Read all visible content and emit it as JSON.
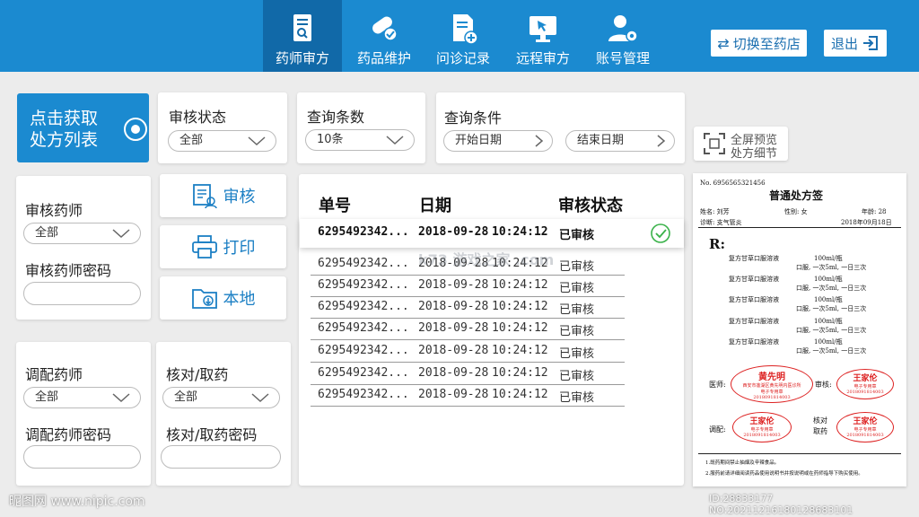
{
  "nav": {
    "items": [
      {
        "label": "药师审方",
        "icon": "clipboard-search-icon",
        "active": true
      },
      {
        "label": "药品维护",
        "icon": "pills-icon"
      },
      {
        "label": "问诊记录",
        "icon": "document-add-icon"
      },
      {
        "label": "远程审方",
        "icon": "monitor-cursor-icon"
      },
      {
        "label": "账号管理",
        "icon": "user-gear-icon"
      }
    ],
    "switch_store": "切换至药店",
    "logout": "退出"
  },
  "fetch_button": "点击获取处方列表",
  "filters": {
    "review_status": {
      "title": "审核状态",
      "value": "全部"
    },
    "query_count": {
      "title": "查询条数",
      "value": "10条"
    },
    "query_cond": {
      "title": "查询条件",
      "start": "开始日期",
      "end": "结束日期"
    },
    "fullscreen": {
      "line1": "全屏预览",
      "line2": "处方细节"
    }
  },
  "left": {
    "reviewer": {
      "title": "审核药师",
      "value": "全部",
      "pwd": "审核药师密码"
    },
    "dispenser": {
      "title": "调配药师",
      "value": "全部",
      "pwd": "调配药师密码"
    },
    "checker": {
      "title": "核对/取药",
      "value": "全部",
      "pwd": "核对/取药密码"
    }
  },
  "actions": {
    "review": "审核",
    "print": "打印",
    "local": "本地"
  },
  "table": {
    "headers": [
      "单号",
      "日期",
      "审核状态"
    ],
    "rows": [
      {
        "id": "6295492342...",
        "date": "2018-09-28",
        "time": "10:24:12",
        "status": "已审核"
      },
      {
        "id": "6295492342...",
        "date": "2018-09-28",
        "time": "10:24:12",
        "status": "已审核"
      },
      {
        "id": "6295492342...",
        "date": "2018-09-28",
        "time": "10:24:12",
        "status": "已审核"
      },
      {
        "id": "6295492342...",
        "date": "2018-09-28",
        "time": "10:24:12",
        "status": "已审核"
      },
      {
        "id": "6295492342...",
        "date": "2018-09-28",
        "time": "10:24:12",
        "status": "已审核"
      },
      {
        "id": "6295492342...",
        "date": "2018-09-28",
        "time": "10:24:12",
        "status": "已审核"
      },
      {
        "id": "6295492342...",
        "date": "2018-09-28",
        "time": "10:24:12",
        "status": "已审核"
      },
      {
        "id": "6295492342...",
        "date": "2018-09-28",
        "time": "10:24:12",
        "status": "已审核"
      }
    ]
  },
  "rx": {
    "no": "No. 6956565321456",
    "title": "普通处方签",
    "name": "姓名: 刘芳",
    "gender": "性别: 女",
    "age": "年龄: 28",
    "diagnosis": "诊断: 支气管炎",
    "date": "2018年09月18日",
    "r": "R:",
    "drug": "复方甘草口服溶液",
    "dose": "100ml/瓶",
    "usage": "口服, 一次5ml, 一日三次",
    "doctor_label": "医师:",
    "review_label": "审核:",
    "dispense_label": "调配:",
    "check_label_1": "核对",
    "check_label_2": "取药",
    "stamp_doctor": "黄先明",
    "stamp_doctor_sub": "西安市莲湖区黄先明内医诊所",
    "stamp_pharm": "王家伦",
    "stamp_sub": "电子专用章",
    "stamp_code": "2018091814003",
    "note1": "1.既药期间禁止抽烟及辛辣食品。",
    "note2": "2.服药前请详细阅读药品使用说明书并按说明或在药师指导下购买使用。"
  },
  "watermarks": {
    "left": "昵图网 www.nipic.com",
    "right": "ID:28833177 NO:20211216180128683101",
    "center": "k73 游戏之家 .com"
  },
  "colors": {
    "brand": "#1b8ad0",
    "active_nav": "#1169a8",
    "stamp": "#dd2222",
    "ok": "#3ab24a"
  }
}
